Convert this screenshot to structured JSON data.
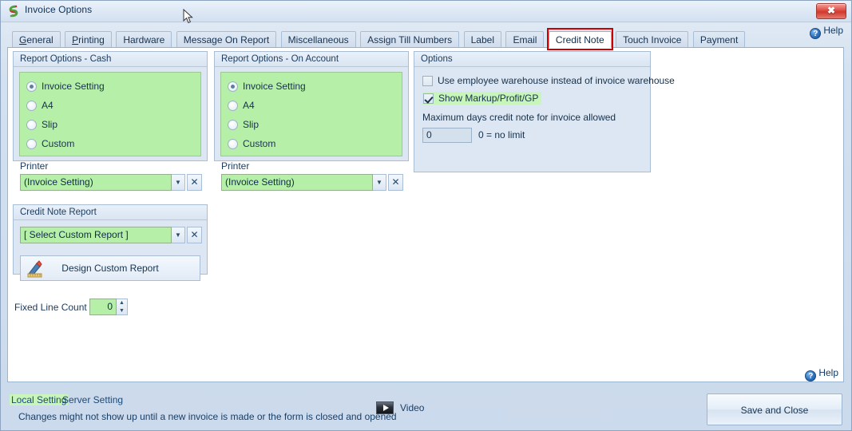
{
  "window": {
    "title": "Invoice Options",
    "app_icon": "swirl-logo-icon",
    "close_label": "✖"
  },
  "help": {
    "top_label": "Help",
    "bottom_label": "Help",
    "icon": "question-circle-icon",
    "glyph": "?"
  },
  "tabs": [
    {
      "label": "General",
      "mnemonic": "G",
      "active": false
    },
    {
      "label": "Printing",
      "mnemonic": "P",
      "active": false
    },
    {
      "label": "Hardware",
      "mnemonic": "",
      "active": false
    },
    {
      "label": "Message On Report",
      "mnemonic": "",
      "active": false
    },
    {
      "label": "Miscellaneous",
      "mnemonic": "",
      "active": false
    },
    {
      "label": "Assign Till Numbers",
      "mnemonic": "",
      "active": false
    },
    {
      "label": "Label",
      "mnemonic": "",
      "active": false
    },
    {
      "label": "Email",
      "mnemonic": "",
      "active": false
    },
    {
      "label": "Credit Note",
      "mnemonic": "",
      "active": true
    },
    {
      "label": "Touch Invoice",
      "mnemonic": "",
      "active": false
    },
    {
      "label": "Payment",
      "mnemonic": "",
      "active": false
    }
  ],
  "highlight_color": "#cc0000",
  "report_options_cash": {
    "title": "Report Options - Cash",
    "radios": [
      {
        "label": "Invoice Setting",
        "selected": true
      },
      {
        "label": "A4",
        "selected": false
      },
      {
        "label": "Slip",
        "selected": false
      },
      {
        "label": "Custom",
        "selected": false
      }
    ],
    "printer_label": "Printer",
    "printer_value": "(Invoice Setting)",
    "dropdown_glyph": "▼",
    "clear_glyph": "✕"
  },
  "report_options_on_account": {
    "title": "Report Options - On Account",
    "radios": [
      {
        "label": "Invoice Setting",
        "selected": true
      },
      {
        "label": "A4",
        "selected": false
      },
      {
        "label": "Slip",
        "selected": false
      },
      {
        "label": "Custom",
        "selected": false
      }
    ],
    "printer_label": "Printer",
    "printer_value": "(Invoice Setting)",
    "dropdown_glyph": "▼",
    "clear_glyph": "✕"
  },
  "credit_note_report": {
    "title": "Credit Note Report",
    "report_value": "[ Select Custom Report ]",
    "dropdown_glyph": "▼",
    "clear_glyph": "✕",
    "design_button_label": "Design Custom Report",
    "design_icon": "ruler-pencil-design-icon"
  },
  "options": {
    "title": "Options",
    "checkbox_employee_warehouse": {
      "label": "Use employee warehouse instead of invoice warehouse",
      "checked": false
    },
    "checkbox_show_markup": {
      "label": "Show Markup/Profit/GP",
      "checked": true,
      "highlight": "#c8f5ba"
    },
    "max_days_label": "Maximum days credit note for invoice allowed",
    "max_days_value": "0",
    "max_days_hint": "0 = no limit"
  },
  "fixed_line_count": {
    "label": "Fixed Line Count",
    "value": "0",
    "up_glyph": "▲",
    "down_glyph": "▼"
  },
  "footer": {
    "local_setting": "Local Setting",
    "server_setting": "Server Setting",
    "note": "Changes might not show up until a new invoice is made or the form is closed and opened",
    "video_label": "Video",
    "video_icon": "play-video-icon",
    "save_label": "Save and Close"
  }
}
